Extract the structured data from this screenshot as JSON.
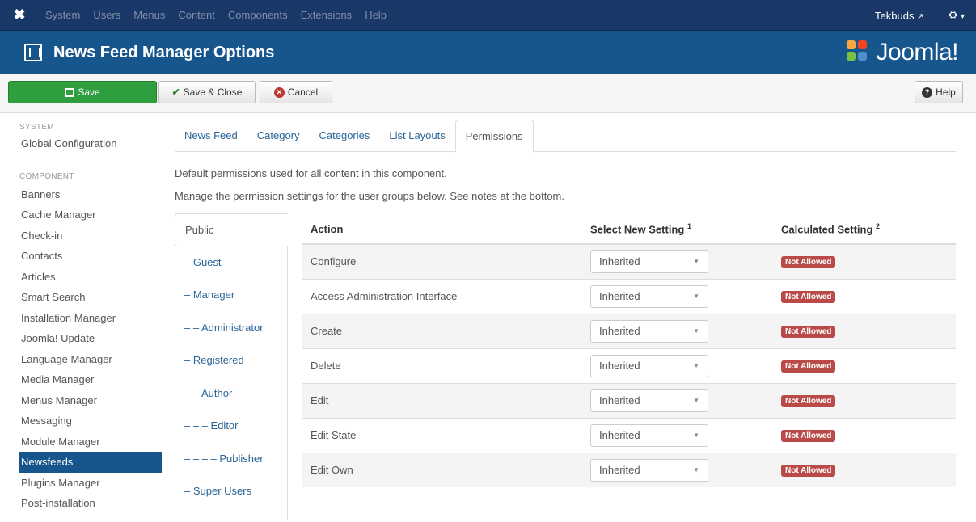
{
  "navbar": {
    "menu": [
      "System",
      "Users",
      "Menus",
      "Content",
      "Components",
      "Extensions",
      "Help"
    ],
    "user": "Tekbuds",
    "settings_caret": "▾"
  },
  "header": {
    "title": "News Feed Manager Options",
    "brand": "Joomla!"
  },
  "toolbar": {
    "save": "Save",
    "save_close": "Save & Close",
    "cancel": "Cancel",
    "help": "Help"
  },
  "sidebar": {
    "system_heading": "SYSTEM",
    "system_items": [
      "Global Configuration"
    ],
    "component_heading": "COMPONENT",
    "component_items": [
      "Banners",
      "Cache Manager",
      "Check-in",
      "Contacts",
      "Articles",
      "Smart Search",
      "Installation Manager",
      "Joomla! Update",
      "Language Manager",
      "Media Manager",
      "Menus Manager",
      "Messaging",
      "Module Manager",
      "Newsfeeds",
      "Plugins Manager",
      "Post-installation"
    ],
    "active_item": "Newsfeeds"
  },
  "tabs": [
    "News Feed",
    "Category",
    "Categories",
    "List Layouts",
    "Permissions"
  ],
  "active_tab": "Permissions",
  "intro": {
    "line1": "Default permissions used for all content in this component.",
    "line2": "Manage the permission settings for the user groups below. See notes at the bottom."
  },
  "groups": [
    "Public",
    "– Guest",
    "– Manager",
    "– – Administrator",
    "– Registered",
    "– – Author",
    "– – – Editor",
    "– – – – Publisher",
    "– Super Users"
  ],
  "active_group": "Public",
  "table": {
    "headers": {
      "action": "Action",
      "select": "Select New Setting",
      "select_sup": "1",
      "calculated": "Calculated Setting",
      "calculated_sup": "2"
    },
    "rows": [
      {
        "action": "Configure",
        "setting": "Inherited",
        "calculated": "Not Allowed"
      },
      {
        "action": "Access Administration Interface",
        "setting": "Inherited",
        "calculated": "Not Allowed"
      },
      {
        "action": "Create",
        "setting": "Inherited",
        "calculated": "Not Allowed"
      },
      {
        "action": "Delete",
        "setting": "Inherited",
        "calculated": "Not Allowed"
      },
      {
        "action": "Edit",
        "setting": "Inherited",
        "calculated": "Not Allowed"
      },
      {
        "action": "Edit State",
        "setting": "Inherited",
        "calculated": "Not Allowed"
      },
      {
        "action": "Edit Own",
        "setting": "Inherited",
        "calculated": "Not Allowed"
      }
    ]
  },
  "colors": {
    "navbar": "#1a3867",
    "header": "#17568c",
    "save_button": "#2f9e3e",
    "badge_not_allowed": "#b94a48",
    "link": "#2a6496"
  }
}
